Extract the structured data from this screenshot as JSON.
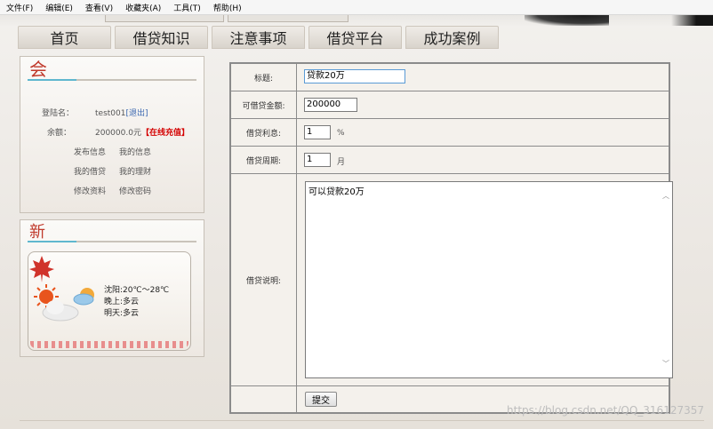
{
  "menu": [
    "文件(F)",
    "编辑(E)",
    "查看(V)",
    "收藏夹(A)",
    "工具(T)",
    "帮助(H)"
  ],
  "nav": [
    "首页",
    "借贷知识",
    "注意事项",
    "借贷平台",
    "成功案例"
  ],
  "user_panel": {
    "title_glyph": "会",
    "login_label": "登陆名：",
    "username": "test001",
    "logout_link": "[退出]",
    "balance_label": "余额：",
    "balance_value": "200000.0元",
    "recharge_link": "【在线充值】",
    "links": [
      "发布信息",
      "我的信息",
      "我的借贷",
      "我的理财",
      "修改资料",
      "修改密码"
    ]
  },
  "weather_panel": {
    "title_glyph": "新",
    "line1": "沈阳:20℃～28℃",
    "line2": "晚上:多云",
    "line3": "明天:多云"
  },
  "form": {
    "title_label": "标题:",
    "title_value": "贷款20万",
    "amount_label": "可借贷金额:",
    "amount_value": "200000",
    "rate_label": "借贷利息:",
    "rate_value": "1",
    "rate_unit": "%",
    "period_label": "借贷周期:",
    "period_value": "1",
    "period_unit": "月",
    "desc_label": "借贷说明:",
    "desc_value": "可以贷款20万",
    "submit_label": "提交"
  },
  "watermark": "https://blog.csdn.net/QQ_316127357",
  "colors": {
    "accent_red": "#c0392b",
    "link_blue": "#3a67b0",
    "recharge_red": "#d40000",
    "divider_teal": "#5fb7cf"
  }
}
